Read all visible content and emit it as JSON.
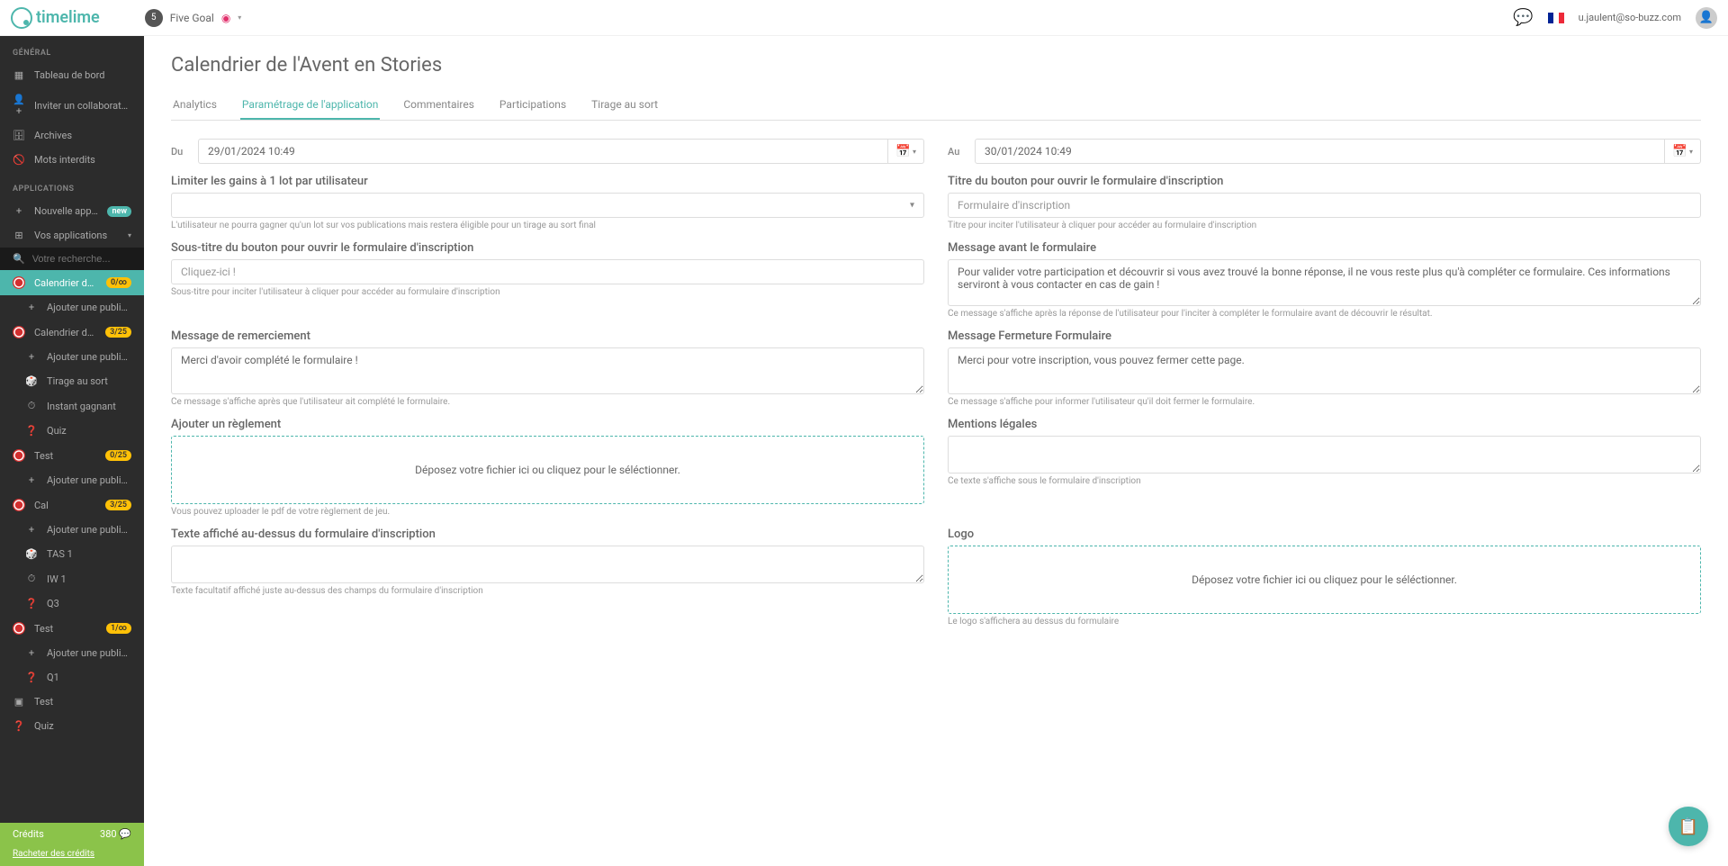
{
  "header": {
    "logo": "timelime",
    "account": "Five Goal",
    "avatarNum": "5",
    "userEmail": "u.jaulent@so-buzz.com"
  },
  "sidebar": {
    "section1": "GÉNÉRAL",
    "general": [
      {
        "icon": "▦",
        "label": "Tableau de bord"
      },
      {
        "icon": "👤+",
        "label": "Inviter un collaborateur"
      },
      {
        "icon": "🗄",
        "label": "Archives"
      },
      {
        "icon": "🚫",
        "label": "Mots interdits"
      }
    ],
    "section2": "APPLICATIONS",
    "newApp": {
      "label": "Nouvelle application",
      "badge": "new"
    },
    "yourApps": "Vos applications",
    "searchPlaceholder": "Votre recherche...",
    "apps": [
      {
        "label": "Calendrier de l'A...",
        "badge": "0/∞",
        "active": true,
        "children": [
          {
            "label": "Ajouter une publication",
            "icon": "+"
          }
        ]
      },
      {
        "label": "Calendrier de l'A...",
        "badge": "3/25",
        "children": [
          {
            "label": "Ajouter une publication",
            "icon": "+"
          },
          {
            "label": "Tirage au sort",
            "icon": "🎲"
          },
          {
            "label": "Instant gagnant",
            "icon": "⏱"
          },
          {
            "label": "Quiz",
            "icon": "❓"
          }
        ]
      },
      {
        "label": "Test",
        "badge": "0/25",
        "children": [
          {
            "label": "Ajouter une publication",
            "icon": "+"
          }
        ]
      },
      {
        "label": "Cal",
        "badge": "3/25",
        "children": [
          {
            "label": "Ajouter une publication",
            "icon": "+"
          },
          {
            "label": "TAS 1",
            "icon": "🎲"
          },
          {
            "label": "IW 1",
            "icon": "⏱"
          },
          {
            "label": "Q3",
            "icon": "❓"
          }
        ]
      },
      {
        "label": "Test",
        "badge": "1/∞",
        "children": [
          {
            "label": "Ajouter une publication",
            "icon": "+"
          },
          {
            "label": "Q1",
            "icon": "❓"
          }
        ]
      },
      {
        "label": "Test",
        "icon": "▣"
      },
      {
        "label": "Quiz",
        "icon": "❓"
      }
    ],
    "creditsLabel": "Crédits",
    "creditsValue": "380 💬",
    "buyCredits": "Racheter des crédits"
  },
  "page": {
    "title": "Calendrier de l'Avent en Stories",
    "tabs": [
      "Analytics",
      "Paramétrage de l'application",
      "Commentaires",
      "Participations",
      "Tirage au sort"
    ],
    "activeTab": 1
  },
  "form": {
    "du": {
      "label": "Du",
      "value": "29/01/2024 10:49"
    },
    "au": {
      "label": "Au",
      "value": "30/01/2024 10:49"
    },
    "limitGains": {
      "label": "Limiter les gains à 1 lot par utilisateur",
      "help": "L'utilisateur ne pourra gagner qu'un lot sur vos publications mais restera éligible pour un tirage au sort final"
    },
    "buttonTitle": {
      "label": "Titre du bouton pour ouvrir le formulaire d'inscription",
      "placeholder": "Formulaire d'inscription",
      "help": "Titre pour inciter l'utilisateur à cliquer pour accéder au formulaire d'inscription"
    },
    "buttonSubtitle": {
      "label": "Sous-titre du bouton pour ouvrir le formulaire d'inscription",
      "placeholder": "Cliquez-ici !",
      "help": "Sous-titre pour inciter l'utilisateur à cliquer pour accéder au formulaire d'inscription"
    },
    "msgBefore": {
      "label": "Message avant le formulaire",
      "value": "Pour valider votre participation et découvrir si vous avez trouvé la bonne réponse, il ne vous reste plus qu'à compléter ce formulaire. Ces informations serviront à vous contacter en cas de gain !",
      "help": "Ce message s'affiche après la réponse de l'utilisateur pour l'inciter à compléter le formulaire avant de découvrir le résultat."
    },
    "msgThanks": {
      "label": "Message de remerciement",
      "value": "Merci d'avoir complété le formulaire !",
      "help": "Ce message s'affiche après que l'utilisateur ait complété le formulaire."
    },
    "msgClose": {
      "label": "Message Fermeture Formulaire",
      "value": "Merci pour votre inscription, vous pouvez fermer cette page.",
      "help": "Ce message s'affiche pour informer l'utilisateur qu'il doit fermer le formulaire."
    },
    "rules": {
      "label": "Ajouter un règlement",
      "dropzone": "Déposez votre fichier ici ou cliquez pour le séléctionner.",
      "help": "Vous pouvez uploader le pdf de votre règlement de jeu."
    },
    "legal": {
      "label": "Mentions légales",
      "help": "Ce texte s'affiche sous le formulaire d'inscription"
    },
    "textAbove": {
      "label": "Texte affiché au-dessus du formulaire d'inscription",
      "help": "Texte facultatif affiché juste au-dessus des champs du formulaire d'inscription"
    },
    "logo": {
      "label": "Logo",
      "dropzone": "Déposez votre fichier ici ou cliquez pour le séléctionner.",
      "help": "Le logo s'affichera au dessus du formulaire"
    }
  }
}
